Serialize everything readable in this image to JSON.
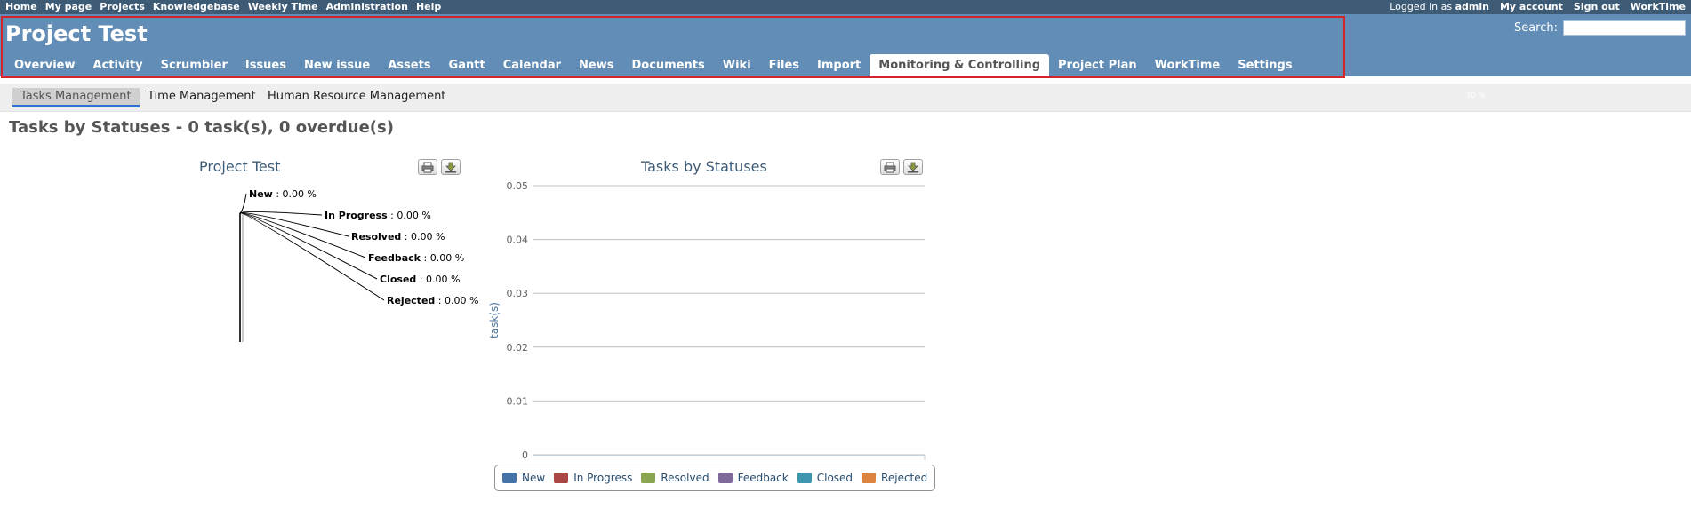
{
  "top_menu": {
    "left": [
      "Home",
      "My page",
      "Projects",
      "Knowledgebase",
      "Weekly Time",
      "Administration",
      "Help"
    ],
    "logged_in_prefix": "Logged in as",
    "logged_in_user": "admin",
    "right": [
      "My account",
      "Sign out",
      "WorkTime"
    ]
  },
  "header": {
    "project_title": "Project Test",
    "search_label": "Search:",
    "search_value": ""
  },
  "main_menu": {
    "tabs": [
      "Overview",
      "Activity",
      "Scrumbler",
      "Issues",
      "New issue",
      "Assets",
      "Gantt",
      "Calendar",
      "News",
      "Documents",
      "Wiki",
      "Files",
      "Import",
      "Monitoring & Controlling",
      "Project Plan",
      "WorkTime",
      "Settings"
    ],
    "selected": "Monitoring & Controlling"
  },
  "subtabs": {
    "tabs": [
      "Tasks Management",
      "Time Management",
      "Human Resource Management"
    ],
    "active": "Tasks Management",
    "percent_text": "30 %"
  },
  "page_heading": "Tasks by Statuses - 0 task(s), 0 overdue(s)",
  "colors": {
    "header_bg": "#628db6",
    "topbar_bg": "#3e5b76",
    "highlight_border": "#d3232b",
    "subtab_active_underline": "#2f6fd6"
  },
  "icons": {
    "print": "print-icon",
    "download": "download-icon"
  },
  "chart_data": [
    {
      "type": "pie",
      "title": "Project Test",
      "labels": [
        "New",
        "In Progress",
        "Resolved",
        "Feedback",
        "Closed",
        "Rejected"
      ],
      "values": [
        0.0,
        0.0,
        0.0,
        0.0,
        0.0,
        0.0
      ],
      "value_text": [
        ": 0.00 %",
        ": 0.00 %",
        ": 0.00 %",
        ": 0.00 %",
        ": 0.00 %",
        ": 0.00 %"
      ]
    },
    {
      "type": "bar",
      "title": "Tasks by Statuses",
      "xlabel": "",
      "ylabel": "task(s)",
      "ylim": [
        0,
        0.05
      ],
      "yticks": [
        "0.05",
        "0.04",
        "0.03",
        "0.02",
        "0.01",
        "0"
      ],
      "grid": true,
      "legend_position": "bottom",
      "series": [
        {
          "name": "New",
          "values": [
            0
          ],
          "color": "#4572a7"
        },
        {
          "name": "In Progress",
          "values": [
            0
          ],
          "color": "#aa4643"
        },
        {
          "name": "Resolved",
          "values": [
            0
          ],
          "color": "#89a54e"
        },
        {
          "name": "Feedback",
          "values": [
            0
          ],
          "color": "#80699b"
        },
        {
          "name": "Closed",
          "values": [
            0
          ],
          "color": "#3d96ae"
        },
        {
          "name": "Rejected",
          "values": [
            0
          ],
          "color": "#db843d"
        }
      ]
    }
  ]
}
